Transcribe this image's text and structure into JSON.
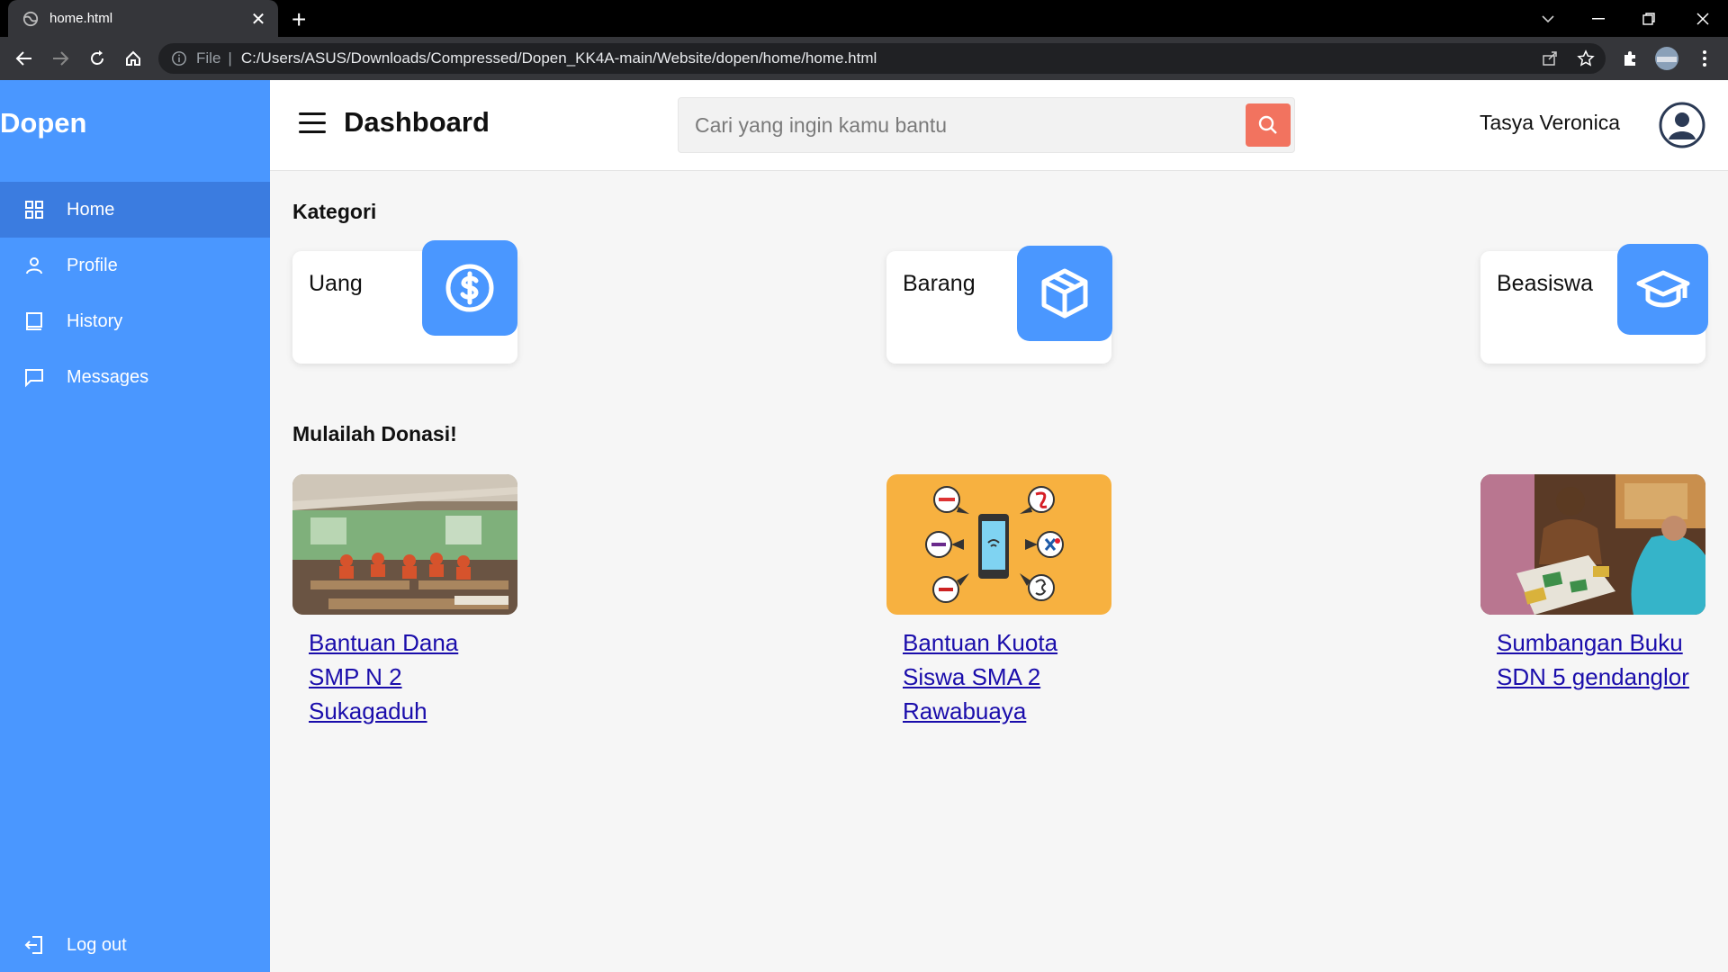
{
  "browser": {
    "tab_title": "home.html",
    "new_tab": "+",
    "address_scheme": "File",
    "address_url": "C:/Users/ASUS/Downloads/Compressed/Dopen_KK4A-main/Website/dopen/home/home.html"
  },
  "sidebar": {
    "brand": "Dopen",
    "items": [
      {
        "label": "Home",
        "icon": "grid-icon"
      },
      {
        "label": "Profile",
        "icon": "user-icon"
      },
      {
        "label": "History",
        "icon": "book-icon"
      },
      {
        "label": "Messages",
        "icon": "chat-icon"
      }
    ],
    "logout_label": "Log out"
  },
  "topbar": {
    "title": "Dashboard",
    "search_placeholder": "Cari yang ingin kamu bantu",
    "user_name": "Tasya Veronica"
  },
  "kategori": {
    "title": "Kategori",
    "items": [
      {
        "label": "Uang",
        "icon": "dollar-icon"
      },
      {
        "label": "Barang",
        "icon": "box-icon"
      },
      {
        "label": "Beasiswa",
        "icon": "graduation-cap-icon"
      }
    ]
  },
  "donasi": {
    "title": "Mulailah Donasi!",
    "items": [
      {
        "title": "Bantuan Dana SMP N 2 Sukagaduh",
        "image": "classroom-photo"
      },
      {
        "title": "Bantuan Kuota Siswa SMA 2 Rawabuaya",
        "image": "phone-providers-illustration"
      },
      {
        "title": "Sumbangan Buku SDN 5 gendanglor",
        "image": "books-photo"
      }
    ]
  },
  "colors": {
    "sidebar": "#4a97ff",
    "sidebar_active": "#3b7ce0",
    "search_button": "#f2735f",
    "link": "#1a0dab"
  }
}
